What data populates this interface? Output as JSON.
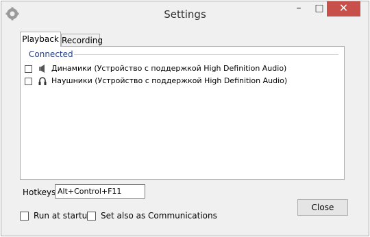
{
  "window": {
    "title": "Settings",
    "minimize_label": "–",
    "maximize_label": "□",
    "close_label": "✕"
  },
  "tabs": [
    {
      "label": "Playback",
      "active": true
    },
    {
      "label": "Recording",
      "active": false
    }
  ],
  "playback": {
    "group_label": "Connected",
    "devices": [
      {
        "label": "Динамики (Устройство с поддержкой High Definition Audio)",
        "icon": "speaker-icon",
        "checked": false
      },
      {
        "label": "Наушники (Устройство с поддержкой High Definition Audio)",
        "icon": "headphones-icon",
        "checked": false
      }
    ]
  },
  "hotkeys": {
    "label": "Hotkeys",
    "value": "Alt+Control+F11"
  },
  "options": {
    "run_at_startup_label": "Run at startup",
    "run_at_startup_checked": false,
    "set_communications_label": "Set also as Communications",
    "set_communications_checked": false
  },
  "buttons": {
    "close_label": "Close"
  },
  "colors": {
    "close_button_bg": "#c7504b",
    "group_header": "#1e3d8a"
  }
}
